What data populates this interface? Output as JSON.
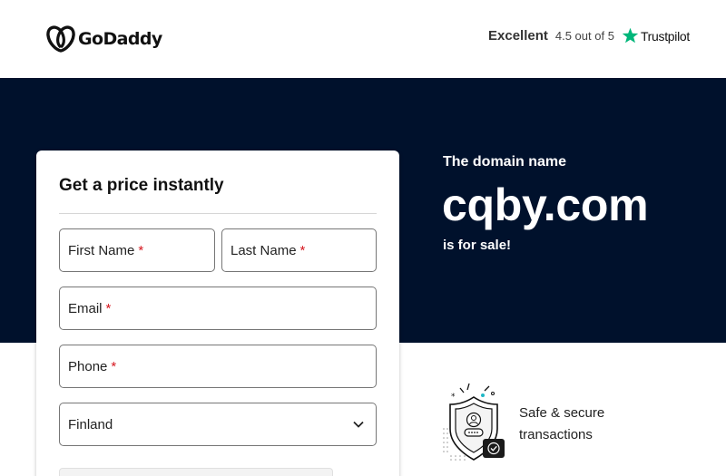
{
  "header": {
    "brand": "GoDaddy",
    "rating_word": "Excellent",
    "rating_score": "4.5 out of 5",
    "trustpilot_label": "Trustpilot",
    "trustpilot_color": "#00b67a"
  },
  "hero": {
    "pre_text": "The domain name",
    "domain": "cqby.com",
    "post_text": "is for sale!",
    "background": "#00112c"
  },
  "form": {
    "title": "Get a price instantly",
    "required_marker": "*",
    "fields": {
      "first_name": "First Name",
      "last_name": "Last Name",
      "email": "Email",
      "phone": "Phone",
      "country": "Finland"
    }
  },
  "safe": {
    "line1": "Safe & secure",
    "line2": "transactions",
    "icon": "shield-lock-icon"
  }
}
